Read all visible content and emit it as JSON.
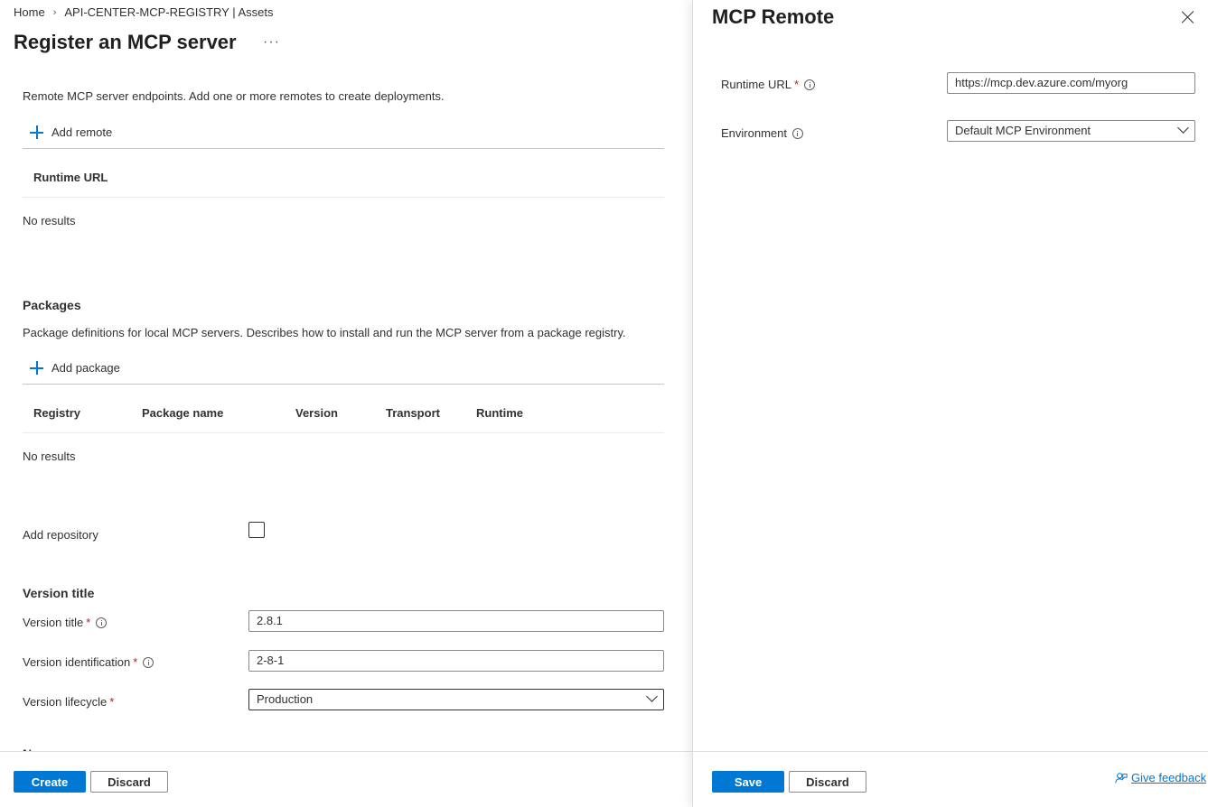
{
  "breadcrumb": {
    "home": "Home",
    "resource": "API-CENTER-MCP-REGISTRY | Assets"
  },
  "page": {
    "title": "Register an MCP server",
    "more": "···"
  },
  "remotes": {
    "description": "Remote MCP server endpoints. Add one or more remotes to create deployments.",
    "add_label": "Add remote",
    "columns": [
      "Runtime URL"
    ],
    "empty": "No results"
  },
  "packages": {
    "heading": "Packages",
    "description": "Package definitions for local MCP servers. Describes how to install and run the MCP server from a package registry.",
    "add_label": "Add package",
    "columns": [
      "Registry",
      "Package name",
      "Version",
      "Transport",
      "Runtime"
    ],
    "empty": "No results"
  },
  "repository": {
    "label": "Add repository",
    "checked": false
  },
  "version": {
    "heading": "Version title",
    "title_label": "Version title",
    "title_value": "2.8.1",
    "id_label": "Version identification",
    "id_value": "2-8-1",
    "lifecycle_label": "Version lifecycle",
    "lifecycle_value": "Production",
    "required_mark": "*"
  },
  "cut_heading": "Na",
  "footer": {
    "create": "Create",
    "discard": "Discard"
  },
  "panel": {
    "title": "MCP Remote",
    "runtime_url_label": "Runtime URL",
    "runtime_url_value": "https://mcp.dev.azure.com/myorg",
    "environment_label": "Environment",
    "environment_value": "Default MCP Environment",
    "required_mark": "*",
    "save": "Save",
    "discard": "Discard",
    "feedback": "Give feedback"
  },
  "icons": {
    "add": "plus-icon",
    "info": "info-icon",
    "close": "close-icon",
    "dropdown": "chevron-down-icon",
    "feedback": "feedback-icon"
  },
  "colors": {
    "accent": "#0078d4",
    "required": "#a4262c",
    "text": "#323130"
  }
}
